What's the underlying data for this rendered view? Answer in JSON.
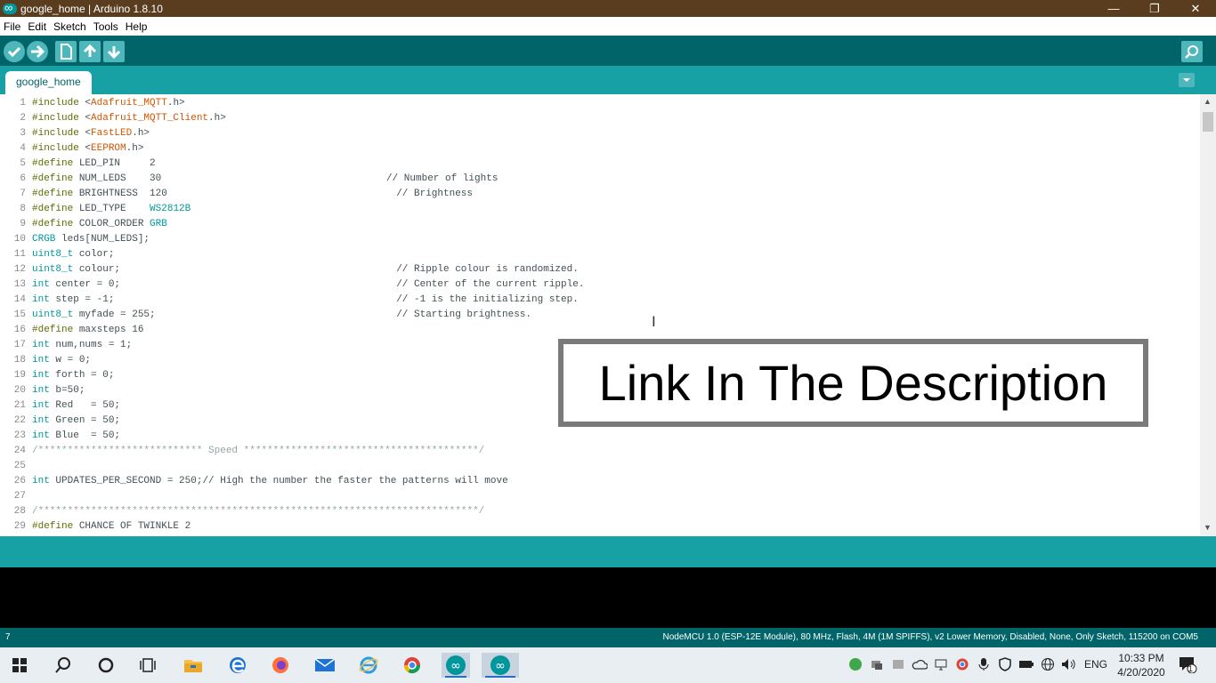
{
  "window": {
    "title": "google_home | Arduino 1.8.10",
    "minimize": "—",
    "maximize": "❐",
    "close": "✕"
  },
  "menu": [
    "File",
    "Edit",
    "Sketch",
    "Tools",
    "Help"
  ],
  "toolbar": {
    "verify_icon": "check-icon",
    "upload_icon": "arrow-right-icon",
    "new_icon": "file-icon",
    "open_icon": "arrow-up-icon",
    "save_icon": "arrow-down-icon",
    "serial_monitor_icon": "magnifier-icon"
  },
  "tabs": [
    {
      "label": "google_home"
    }
  ],
  "editor": {
    "lines": [
      {
        "n": "1",
        "code": "#include <Adafruit_MQTT.h>"
      },
      {
        "n": "2",
        "code": "#include <Adafruit_MQTT_Client.h>"
      },
      {
        "n": "3",
        "code": "#include <FastLED.h>"
      },
      {
        "n": "4",
        "code": "#include <EEPROM.h>"
      },
      {
        "n": "5",
        "code": "#define LED_PIN     2"
      },
      {
        "n": "6",
        "code": "#define NUM_LEDS    30",
        "comment": "// Number of lights",
        "comment_col": 60
      },
      {
        "n": "7",
        "code": "#define BRIGHTNESS  120",
        "comment": "// Brightness",
        "comment_col": 62
      },
      {
        "n": "8",
        "code": "#define LED_TYPE    WS2812B"
      },
      {
        "n": "9",
        "code": "#define COLOR_ORDER GRB"
      },
      {
        "n": "10",
        "code": "CRGB leds[NUM_LEDS];"
      },
      {
        "n": "11",
        "code": "uint8_t color;"
      },
      {
        "n": "12",
        "code": "uint8_t colour;",
        "comment": "// Ripple colour is randomized.",
        "comment_col": 62
      },
      {
        "n": "13",
        "code": "int center = 0;",
        "comment": "// Center of the current ripple.",
        "comment_col": 62
      },
      {
        "n": "14",
        "code": "int step = -1;",
        "comment": "// -1 is the initializing step.",
        "comment_col": 62
      },
      {
        "n": "15",
        "code": "uint8_t myfade = 255;",
        "comment": "// Starting brightness.",
        "comment_col": 62
      },
      {
        "n": "16",
        "code": "#define maxsteps 16"
      },
      {
        "n": "17",
        "code": "int num,nums = 1;"
      },
      {
        "n": "18",
        "code": "int w = 0;"
      },
      {
        "n": "19",
        "code": "int forth = 0;"
      },
      {
        "n": "20",
        "code": "int b=50;"
      },
      {
        "n": "21",
        "code": "int Red   = 50;"
      },
      {
        "n": "22",
        "code": "int Green = 50;"
      },
      {
        "n": "23",
        "code": "int Blue  = 50;"
      },
      {
        "n": "24",
        "code": "/**************************** Speed ****************************************/"
      },
      {
        "n": "25",
        "code": ""
      },
      {
        "n": "26",
        "code": "int UPDATES_PER_SECOND = 250;// High the number the faster the patterns will move"
      },
      {
        "n": "27",
        "code": ""
      },
      {
        "n": "28",
        "code": "/***************************************************************************/"
      },
      {
        "n": "29",
        "code": "#define CHANCE OF TWINKLE 2"
      }
    ]
  },
  "overlay": {
    "text": "Link In The Description"
  },
  "status": {
    "line": "7",
    "board": "NodeMCU 1.0 (ESP-12E Module), 80 MHz, Flash, 4M (1M SPIFFS), v2 Lower Memory, Disabled, None, Only Sketch, 115200 on COM5"
  },
  "taskbar": {
    "apps": [
      "windows-start-icon",
      "search-icon",
      "cortana-icon",
      "task-view-icon",
      "file-explorer-icon",
      "edge-icon",
      "firefox-icon",
      "mail-icon",
      "ie-icon",
      "chrome-icon",
      "arduino-icon",
      "arduino-icon"
    ],
    "tray": {
      "language": "ENG",
      "time": "10:33 PM",
      "date": "4/20/2020",
      "notification_count": "1"
    }
  }
}
